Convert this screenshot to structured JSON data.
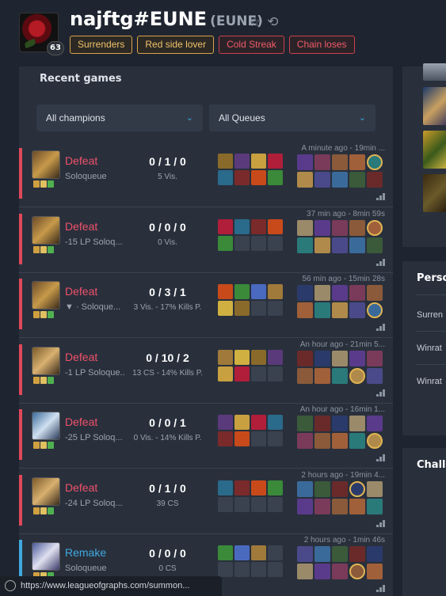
{
  "profile": {
    "name": "najftg#EUNE",
    "region": "(EUNE)",
    "level": "63",
    "tags_gold": [
      "Surrenders",
      "Red side lover"
    ],
    "tags_red": [
      "Cold Streak",
      "Chain loses"
    ]
  },
  "recent": {
    "title": "Recent games",
    "champion_filter": "All champions",
    "queue_filter": "All Queues"
  },
  "games": [
    {
      "result": "Defeat",
      "queue": "Soloqueue",
      "kda": "0 / 1 / 0",
      "stats": "5 Vis.",
      "time": "A minute ago - 19min ..."
    },
    {
      "result": "Defeat",
      "queue": "-15 LP Soloq...",
      "kda": "0 / 0 / 0",
      "stats": "0 Vis.",
      "time": "37 min ago - 8min 59s"
    },
    {
      "result": "Defeat",
      "queue": "▼ · Soloque...",
      "kda": "0 / 3 / 1",
      "stats": "3 Vis. - 17% Kills P.",
      "time": "56 min ago - 15min 28s"
    },
    {
      "result": "Defeat",
      "queue": "-1 LP Soloque...",
      "kda": "0 / 10 / 2",
      "stats": "13 CS - 14% Kills P.",
      "time": "An hour ago - 21min 5..."
    },
    {
      "result": "Defeat",
      "queue": "-25 LP Soloq...",
      "kda": "0 / 0 / 1",
      "stats": "0 Vis. - 14% Kills P.",
      "time": "An hour ago - 16min 1..."
    },
    {
      "result": "Defeat",
      "queue": "-24 LP Soloq...",
      "kda": "0 / 1 / 0",
      "stats": "39 CS",
      "time": "2 hours ago - 19min 4..."
    },
    {
      "result": "Remake",
      "queue": "Soloqueue",
      "kda": "0 / 0 / 0",
      "stats": "0 CS",
      "time": "2 hours ago - 1min 46s"
    }
  ],
  "side": {
    "personal_title": "Perso",
    "rows": [
      "Surren",
      "Winrat",
      "Winrat"
    ],
    "challenges_title": "Challe"
  },
  "status_url": "https://www.leagueofgraphs.com/summon..."
}
